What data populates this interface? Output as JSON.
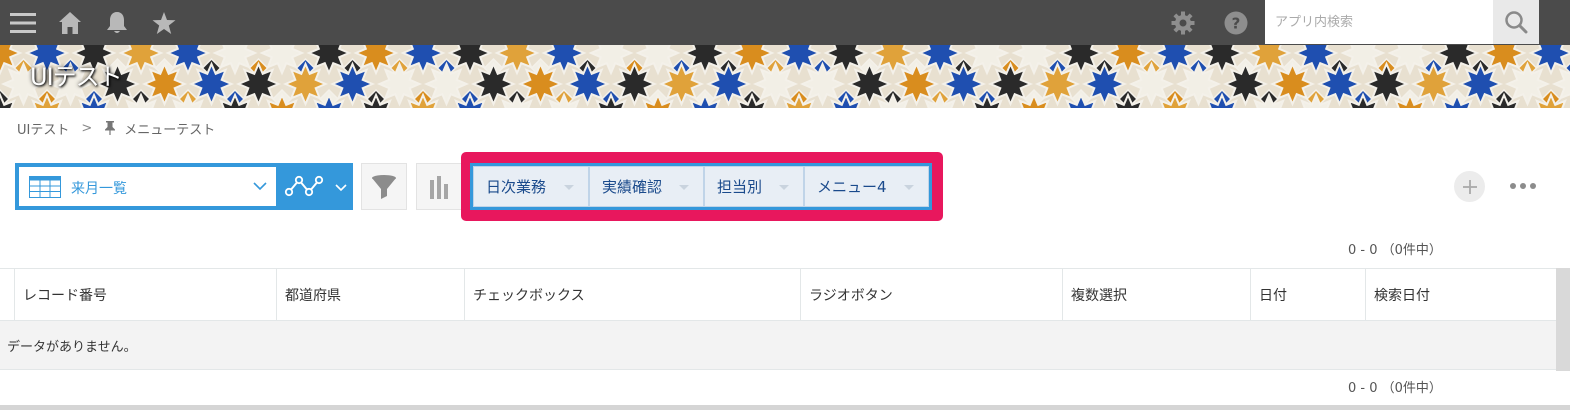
{
  "search": {
    "placeholder": "アプリ内検索"
  },
  "banner": {
    "title": "UIテスト"
  },
  "breadcrumb": {
    "app": "UIテスト",
    "separator": ">",
    "view": "メニューテスト"
  },
  "toolbar": {
    "view_name": "来月一覧",
    "menu_buttons": [
      "日次業務",
      "実績確認",
      "担当別",
      "メニュー4"
    ]
  },
  "pager": {
    "top": "0 - 0 （0件中）",
    "bottom": "0 - 0 （0件中）"
  },
  "table": {
    "columns": [
      "レコード番号",
      "都道府県",
      "チェックボックス",
      "ラジオボタン",
      "複数選択",
      "日付",
      "検索日付"
    ],
    "empty_message": "データがありません。"
  },
  "colors": {
    "topbar": "#4b4b4b",
    "accent": "#3498db",
    "highlight": "#e8175d"
  },
  "icons": [
    "menu-icon",
    "home-icon",
    "bell-icon",
    "star-icon",
    "gear-icon",
    "help-icon",
    "search-icon",
    "pin-icon",
    "table-icon",
    "chevron-down-icon",
    "graph-icon",
    "filter-icon",
    "bar-chart-icon",
    "plus-icon",
    "more-icon"
  ]
}
